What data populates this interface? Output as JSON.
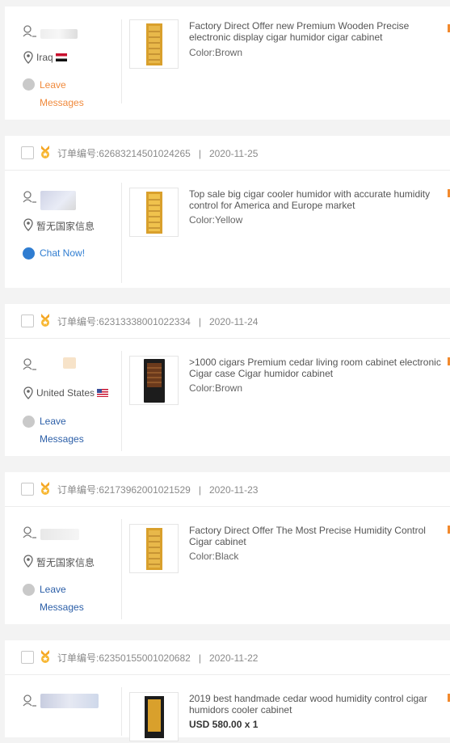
{
  "orders": [
    {
      "order_no": "",
      "date": "",
      "location": "Iraq",
      "action": [
        "Leave",
        "Messages"
      ],
      "product_title": "Factory Direct Offer new Premium Wooden Precise electronic display cigar humidor cigar cabinet",
      "color": "Color:Brown"
    },
    {
      "order_no": "订单编号:62683214501024265",
      "date": "2020-11-25",
      "location": "暂无国家信息",
      "action": [
        "Chat Now!"
      ],
      "product_title": "Top sale big cigar cooler humidor with accurate humidity control for America and Europe market",
      "color": "Color:Yellow"
    },
    {
      "order_no": "订单编号:62313338001022334",
      "date": "2020-11-24",
      "location": "United States",
      "action": [
        "Leave",
        "Messages"
      ],
      "product_title": ">1000 cigars Premium cedar living room cabinet electronic Cigar case Cigar humidor cabinet",
      "color": "Color:Brown"
    },
    {
      "order_no": "订单编号:62173962001021529",
      "date": "2020-11-23",
      "location": "暂无国家信息",
      "action": [
        "Leave",
        "Messages"
      ],
      "product_title": "Factory Direct Offer The Most Precise Humidity Control Cigar cabinet",
      "color": "Color:Black"
    },
    {
      "order_no": "订单编号:62350155001020682",
      "date": "2020-11-22",
      "location": "",
      "action": [],
      "product_title": "2019 best handmade cedar wood humidity control cigar humidors cooler cabinet",
      "color": "USD 580.00 x 1"
    }
  ],
  "separator": "|",
  "colors": {
    "accent_orange": "#f28a2e",
    "chat_blue": "#2f7dd1",
    "link_blue": "#2c5fa8"
  },
  "icons": {
    "buyer": "person-icon",
    "location": "location-pin-icon",
    "medal": "gold-medal-icon"
  }
}
